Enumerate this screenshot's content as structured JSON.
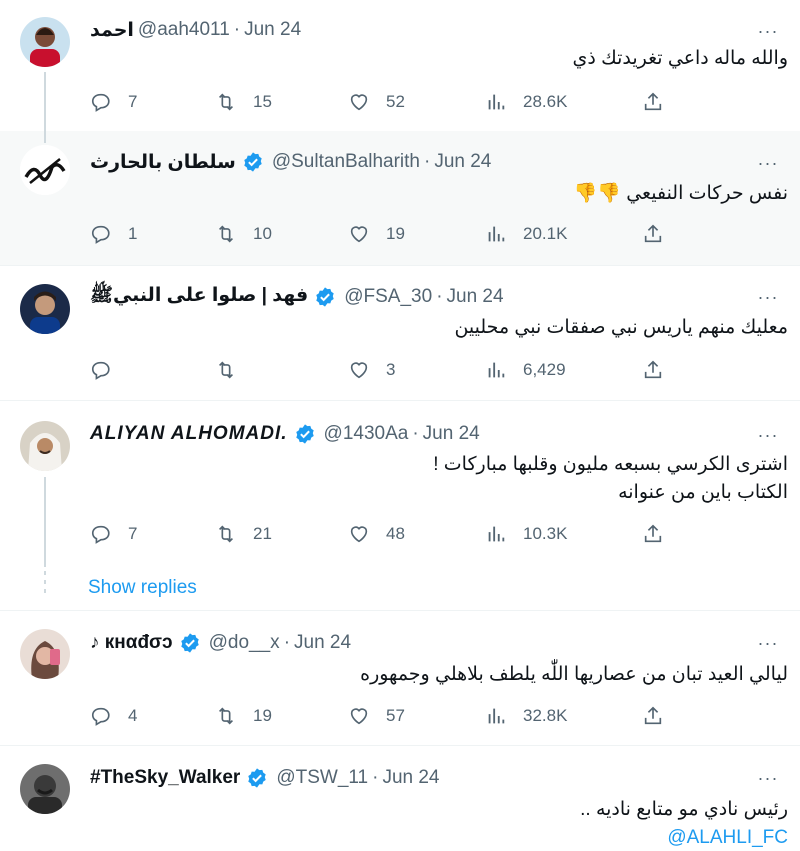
{
  "tweets": [
    {
      "name": "احمد",
      "handle": "@aah4011",
      "date": "Jun 24",
      "verified": false,
      "text_lines": [
        "والله ماله داعي تغريدتك ذي"
      ],
      "replies": "7",
      "retweets": "15",
      "likes": "52",
      "views": "28.6K"
    },
    {
      "name": "سلطان بالحارث",
      "handle": "@SultanBalharith",
      "date": "Jun 24",
      "verified": true,
      "text_lines": [
        "نفس حركات النفيعي 👎👎"
      ],
      "replies": "1",
      "retweets": "10",
      "likes": "19",
      "views": "20.1K"
    },
    {
      "name": "فهد | صلوا على النبيﷺ",
      "handle": "@FSA_30",
      "date": "Jun 24",
      "verified": true,
      "text_lines": [
        "معليك منهم ياريس نبي صفقات نبي محليين"
      ],
      "replies": "",
      "retweets": "",
      "likes": "3",
      "views": "6,429"
    },
    {
      "name": "ALIYAN ALHOMADI.",
      "handle": "@1430Aa",
      "date": "Jun 24",
      "verified": true,
      "text_lines": [
        "اشترى الكرسي بسبعه مليون وقلبها مباركات !",
        "الكتاب باين من عنوانه"
      ],
      "replies": "7",
      "retweets": "21",
      "likes": "48",
      "views": "10.3K"
    },
    {
      "name": "♪ кнαđσɔ",
      "handle": "@do__x",
      "date": "Jun 24",
      "verified": true,
      "text_lines": [
        "ليالي العيد تبان من عصاريها اللّٰه يلطف بلاهلي وجمهوره"
      ],
      "replies": "4",
      "retweets": "19",
      "likes": "57",
      "views": "32.8K"
    },
    {
      "name": "#TheSky_Walker",
      "handle": "@TSW_11",
      "date": "Jun 24",
      "verified": true,
      "text_lines": [
        "رئيس نادي مو متابع ناديه .."
      ],
      "mention": "@ALAHLI_FC"
    }
  ],
  "show_replies_label": "Show replies",
  "separator": "·",
  "more_label": "···",
  "colors": {
    "accent": "#1d9bf0",
    "secondary": "#536471",
    "verified": "#1d9bf0"
  }
}
